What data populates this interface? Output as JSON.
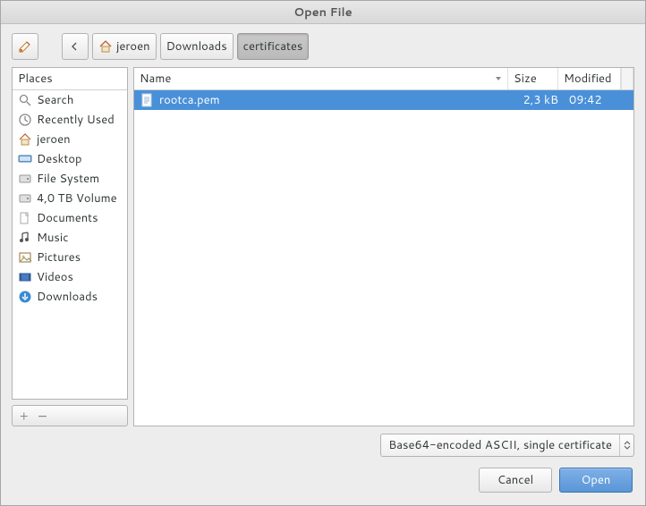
{
  "title": "Open File",
  "breadcrumb": {
    "home_label": "jeroen",
    "items": [
      "Downloads",
      "certificates"
    ],
    "active_index": 1
  },
  "places": {
    "header": "Places",
    "items": [
      {
        "icon": "search-icon",
        "label": "Search"
      },
      {
        "icon": "recent-icon",
        "label": "Recently Used"
      },
      {
        "icon": "home-icon",
        "label": "jeroen"
      },
      {
        "icon": "desktop-icon",
        "label": "Desktop"
      },
      {
        "icon": "disk-icon",
        "label": "File System"
      },
      {
        "icon": "disk-icon",
        "label": "4,0 TB Volume"
      },
      {
        "icon": "folder-icon",
        "label": "Documents"
      },
      {
        "icon": "music-icon",
        "label": "Music"
      },
      {
        "icon": "pictures-icon",
        "label": "Pictures"
      },
      {
        "icon": "videos-icon",
        "label": "Videos"
      },
      {
        "icon": "downloads-icon",
        "label": "Downloads"
      }
    ]
  },
  "columns": {
    "name": "Name",
    "size": "Size",
    "modified": "Modified"
  },
  "files": [
    {
      "name": "rootca.pem",
      "size": "2,3 kB",
      "modified": "09:42",
      "selected": true
    }
  ],
  "filter": "Base64-encoded ASCII, single certificate",
  "buttons": {
    "cancel": "Cancel",
    "open": "Open"
  }
}
